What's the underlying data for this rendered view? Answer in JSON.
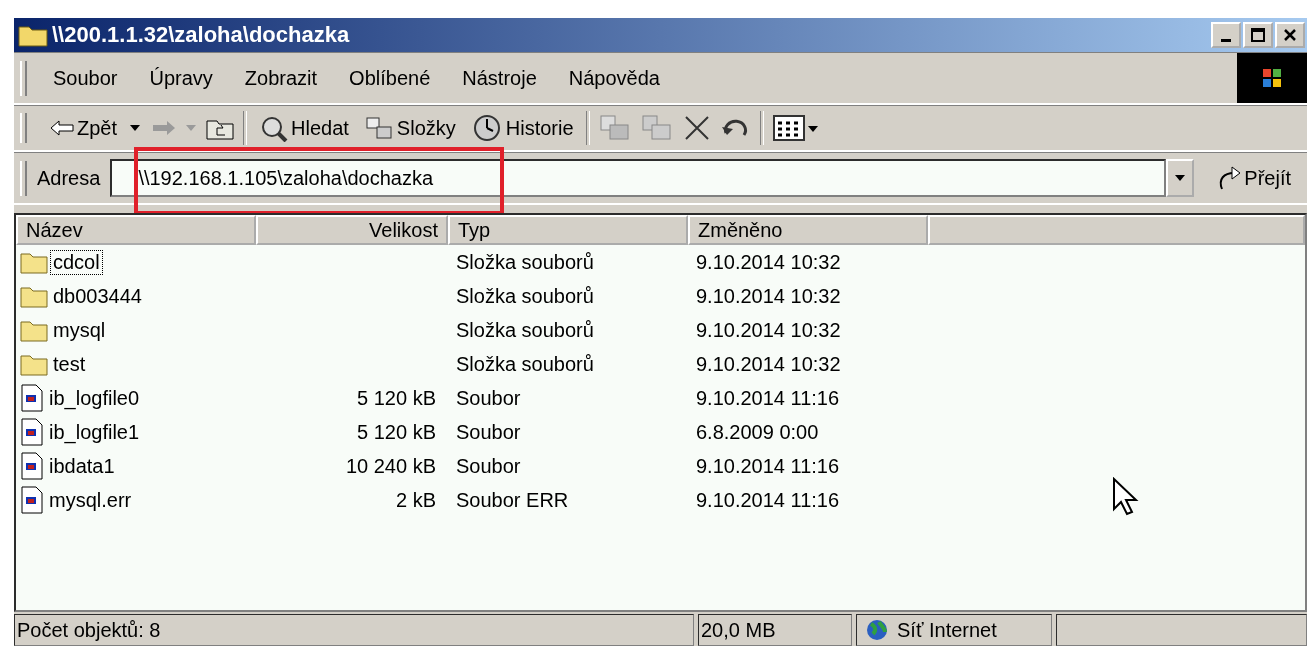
{
  "window": {
    "title": "\\\\200.1.1.32\\zaloha\\dochazka"
  },
  "menu": [
    "Soubor",
    "Úpravy",
    "Zobrazit",
    "Oblíbené",
    "Nástroje",
    "Nápověda"
  ],
  "toolbar": {
    "back": "Zpět",
    "search": "Hledat",
    "folders": "Složky",
    "history": "Historie"
  },
  "address": {
    "label": "Adresa",
    "value": "\\\\192.168.1.105\\zaloha\\dochazka",
    "go": "Přejít",
    "highlighted": true
  },
  "table": {
    "columns": [
      "Název",
      "Velikost",
      "Typ",
      "Změněno"
    ],
    "rows": [
      {
        "kind": "folder",
        "name": "cdcol",
        "size": "",
        "type": "Složka souborů",
        "modified": "9.10.2014 10:32",
        "focused": true
      },
      {
        "kind": "folder",
        "name": "db003444",
        "size": "",
        "type": "Složka souborů",
        "modified": "9.10.2014 10:32",
        "focused": false
      },
      {
        "kind": "folder",
        "name": "mysql",
        "size": "",
        "type": "Složka souborů",
        "modified": "9.10.2014 10:32",
        "focused": false
      },
      {
        "kind": "folder",
        "name": "test",
        "size": "",
        "type": "Složka souborů",
        "modified": "9.10.2014 10:32",
        "focused": false
      },
      {
        "kind": "file",
        "name": "ib_logfile0",
        "size": "5 120 kB",
        "type": "Soubor",
        "modified": "9.10.2014 11:16",
        "focused": false
      },
      {
        "kind": "file",
        "name": "ib_logfile1",
        "size": "5 120 kB",
        "type": "Soubor",
        "modified": "6.8.2009 0:00",
        "focused": false
      },
      {
        "kind": "file",
        "name": "ibdata1",
        "size": "10 240 kB",
        "type": "Soubor",
        "modified": "9.10.2014 11:16",
        "focused": false
      },
      {
        "kind": "file",
        "name": "mysql.err",
        "size": "2 kB",
        "type": "Soubor ERR",
        "modified": "9.10.2014 11:16",
        "focused": false
      }
    ]
  },
  "status_bar": {
    "count": "Počet objektů: 8",
    "size": "20,0 MB",
    "zone": "Síť Internet"
  }
}
